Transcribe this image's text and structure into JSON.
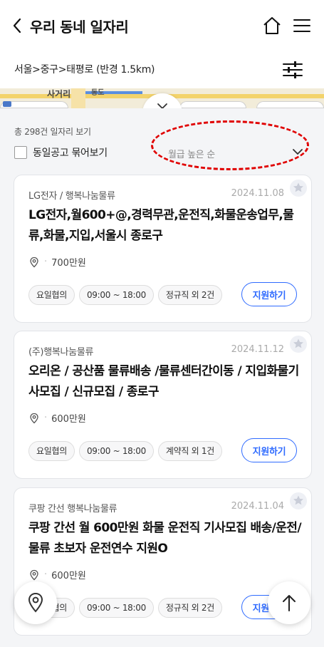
{
  "header": {
    "title": "우리 동네 일자리"
  },
  "location": {
    "text": "서울>중구>태평로 (반경 1.5km)"
  },
  "map": {
    "labels": [
      "사거리",
      "동도"
    ]
  },
  "list": {
    "count_text": "총 298건 일자리 보기",
    "group_label": "동일공고 묶어보기",
    "sort_label": "월급 높은 순"
  },
  "jobs": [
    {
      "company": "LG전자 / 행복나눔물류",
      "date": "2024.11.08",
      "title": "LG전자,월600+@,경력무관,운전직,화물운송업무,물류,화물,지입,서울시 종로구",
      "pay": "700만원",
      "tags": [
        "요일협의",
        "09:00 ~ 18:00",
        "정규직 외 2건"
      ],
      "apply_label": "지원하기"
    },
    {
      "company": "(주)행복나눔물류",
      "date": "2024.11.12",
      "title": "오리온 / 공산품 물류배송 /물류센터간이동 / 지입화물기사모집 / 신규모집 / 종로구",
      "pay": "600만원",
      "tags": [
        "요일협의",
        "09:00 ~ 18:00",
        "계약직 외 1건"
      ],
      "apply_label": "지원하기"
    },
    {
      "company": "쿠팡 간선 행복나눔물류",
      "date": "2024.11.04",
      "title": "쿠팡 간선 월 600만원 화물 운전직 기사모집 배송/운전/물류 초보자 운전연수 지원O",
      "pay": "600만원",
      "tags": [
        "요일협의",
        "09:00 ~ 18:00",
        "정규직 외 2건"
      ],
      "apply_label": "지원하기"
    }
  ],
  "colors": {
    "accent": "#2f6bff",
    "highlight": "#e00000",
    "map_bg": "#f2ecd9"
  }
}
